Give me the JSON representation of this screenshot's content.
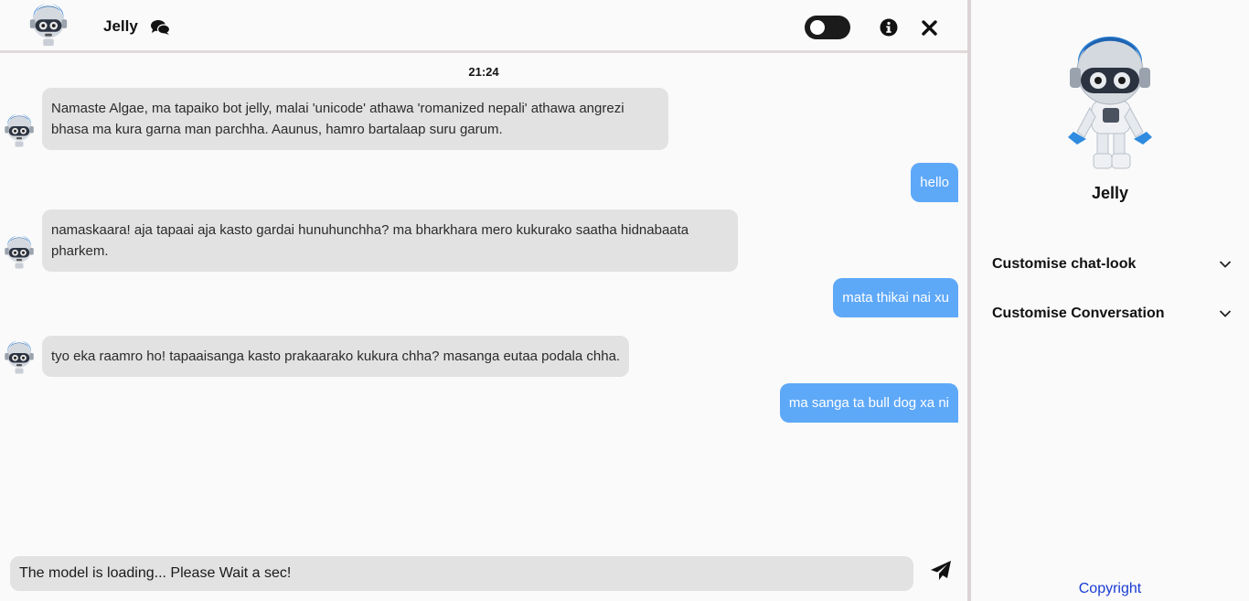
{
  "header": {
    "bot_name": "Jelly"
  },
  "chat": {
    "timestamp": "21:24",
    "messages": [
      {
        "from": "bot",
        "text": "Namaste Algae, ma tapaiko bot jelly, malai 'unicode' athawa 'romanized nepali' athawa angrezi bhasa ma kura garna man parchha. Aaunus, hamro bartalaap suru garum."
      },
      {
        "from": "user",
        "text": "hello"
      },
      {
        "from": "bot",
        "text": "namaskaara! aja tapaai aja kasto gardai hunuhunchha? ma bharkhara mero kukurako saatha hidnabaata pharkem."
      },
      {
        "from": "user",
        "text": "mata thikai nai xu"
      },
      {
        "from": "bot",
        "text": "tyo eka raamro ho! tapaaisanga kasto prakaarako kukura chha? masanga eutaa podala chha."
      },
      {
        "from": "user",
        "text": "ma sanga ta bull dog xa ni"
      }
    ]
  },
  "input": {
    "placeholder": "The model is loading... Please Wait a sec!"
  },
  "sidebar": {
    "bot_name": "Jelly",
    "sections": [
      {
        "label": "Customise chat-look"
      },
      {
        "label": "Customise Conversation"
      }
    ],
    "footer_link": "Copyright"
  },
  "colors": {
    "user_bubble": "#5ea8f8",
    "bot_bubble": "#e2e2e2",
    "link": "#1a3bd4"
  },
  "icons": [
    "robot-avatar",
    "chat-bubbles-icon",
    "theme-toggle",
    "info-icon",
    "close-icon",
    "send-icon",
    "chevron-down-icon"
  ]
}
